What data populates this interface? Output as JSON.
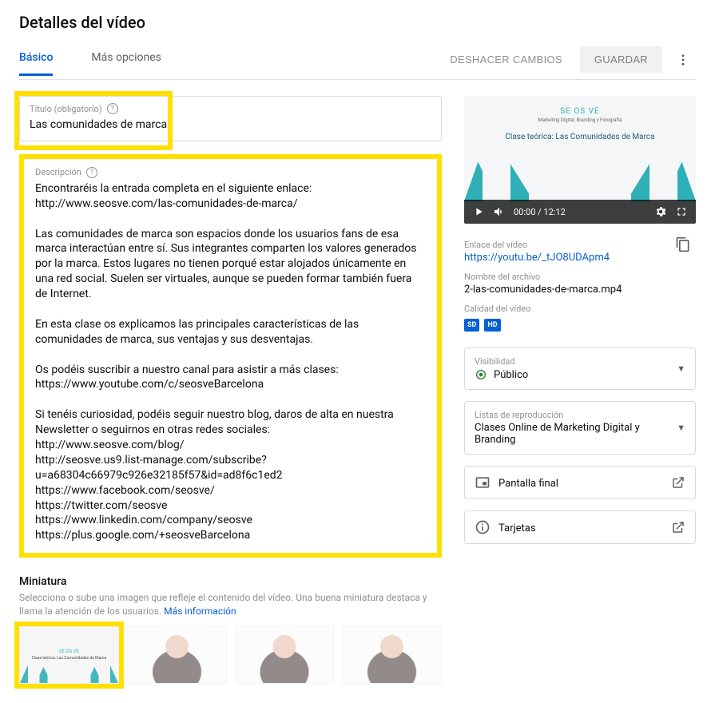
{
  "page_title": "Detalles del vídeo",
  "tabs": {
    "basic": "Básico",
    "more": "Más opciones"
  },
  "actions": {
    "discard": "DESHACER CAMBIOS",
    "save": "GUARDAR"
  },
  "title_field": {
    "label": "Título (obligatorio)",
    "value": "Las comunidades de marca"
  },
  "desc_field": {
    "label": "Descripción",
    "value": "Encontraréis la entrada completa en el siguiente enlace: http://www.seosve.com/las-comunidades-de-marca/\n\nLas comunidades de marca son espacios donde los usuarios fans de esa marca interactúan entre sí. Sus integrantes comparten los valores generados por la marca. Estos lugares no tienen porqué estar alojados únicamente en una red social. Suelen ser virtuales, aunque se pueden formar también fuera de Internet.\n\nEn esta clase os explicamos las principales características de las comunidades de marca, sus ventajas y sus desventajas.\n\nOs podéis suscribir a nuestro canal para asistir a más clases:\nhttps://www.youtube.com/c/seosveBarcelona\n\nSi tenéis curiosidad, podéis seguir nuestro blog, daros de alta en nuestra Newsletter o seguirnos en otras redes sociales:\nhttp://www.seosve.com/blog/\nhttp://seosve.us9.list-manage.com/subscribe?u=a68304c66979c926e32185f57&id=ad8f6c1ed2\nhttps://www.facebook.com/seosve/\nhttps://twitter.com/seosve\nhttps://www.linkedin.com/company/seosve\nhttps://plus.google.com/+seosveBarcelona"
  },
  "thumbnail_section": {
    "title": "Miniatura",
    "desc": "Selecciona o sube una imagen que refleje el contenido del vídeo. Una buena miniatura destaca y llama la atención de los usuarios. ",
    "more": "Más información"
  },
  "preview": {
    "brand": "SE OS VE",
    "brand_sub": "Marketing Digital, Branding y Fotografía",
    "slide_title": "Clase teórica: Las Comunidades de Marca",
    "time_current": "00:00",
    "time_total": "12:12"
  },
  "meta": {
    "link_label": "Enlace del vídeo",
    "link_value": "https://youtu.be/_tJO8UDApm4",
    "filename_label": "Nombre del archivo",
    "filename_value": "2-las-comunidades-de-marca.mp4",
    "quality_label": "Calidad del vídeo",
    "badge_sd": "SD",
    "badge_hd": "HD"
  },
  "visibility": {
    "label": "Visibilidad",
    "value": "Público"
  },
  "playlists": {
    "label": "Listas de reproducción",
    "value": "Clases Online de Marketing Digital y Branding"
  },
  "endscreen": {
    "label": "Pantalla final"
  },
  "cards": {
    "label": "Tarjetas"
  }
}
